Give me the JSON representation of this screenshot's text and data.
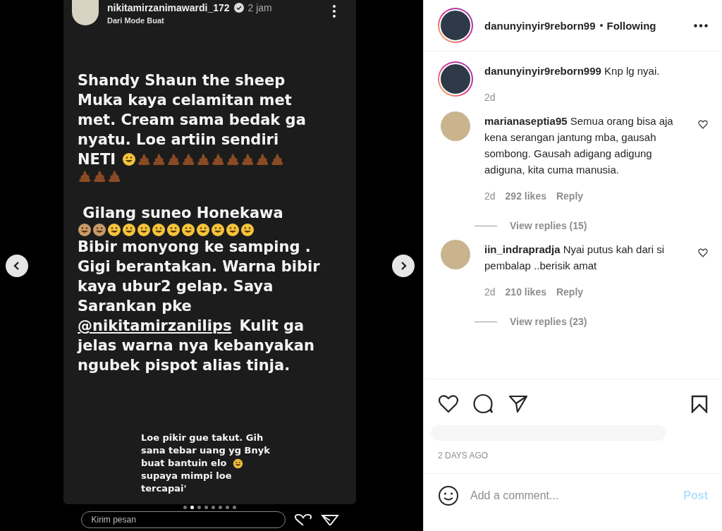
{
  "story": {
    "username": "nikitamirzanimawardi_172",
    "verified": true,
    "time": "2 jam",
    "subtitle": "Dari Mode Buat",
    "blocks": [
      {
        "kind": "caption",
        "lines": [
          [
            {
              "kind": "text",
              "text": "Shandy Shaun the sheep"
            }
          ],
          [
            {
              "kind": "text",
              "text": "Muka kaya celamitan met"
            }
          ],
          [
            {
              "kind": "text",
              "text": "met. Cream sama bedak ga"
            }
          ],
          [
            {
              "kind": "text",
              "text": "nyatu. Loe artiin sendiri"
            }
          ],
          [
            {
              "kind": "text",
              "text": "NETI"
            },
            {
              "kind": "laugh"
            },
            {
              "kind": "poop"
            },
            {
              "kind": "poop"
            },
            {
              "kind": "poop"
            },
            {
              "kind": "poop"
            },
            {
              "kind": "poop"
            },
            {
              "kind": "poop"
            },
            {
              "kind": "poop"
            },
            {
              "kind": "poop"
            },
            {
              "kind": "poop"
            },
            {
              "kind": "poop"
            }
          ],
          [
            {
              "kind": "poop"
            },
            {
              "kind": "poop"
            },
            {
              "kind": "poop"
            }
          ]
        ]
      },
      {
        "kind": "caption",
        "lines": [
          [
            {
              "kind": "text",
              "text": " Gilang suneo Honekawa"
            }
          ],
          [
            {
              "kind": "monkey"
            },
            {
              "kind": "monkey"
            },
            {
              "kind": "laugh"
            },
            {
              "kind": "laugh"
            },
            {
              "kind": "laugh"
            },
            {
              "kind": "laugh"
            },
            {
              "kind": "laugh"
            },
            {
              "kind": "laugh"
            },
            {
              "kind": "laugh"
            },
            {
              "kind": "laugh"
            },
            {
              "kind": "laugh"
            },
            {
              "kind": "laugh"
            }
          ],
          [
            {
              "kind": "text",
              "text": "Bibir monyong ke samping ."
            }
          ],
          [
            {
              "kind": "text",
              "text": "Gigi berantakan. Warna bibir"
            }
          ],
          [
            {
              "kind": "text",
              "text": "kaya ubur2 gelap. Saya"
            }
          ],
          [
            {
              "kind": "text",
              "text": "Sarankan pke"
            }
          ],
          [
            {
              "kind": "link",
              "text": "@nikitamirzanilips"
            },
            {
              "kind": "text",
              "text": "Kulit ga"
            }
          ],
          [
            {
              "kind": "text",
              "text": "jelas warna nya kebanyakan"
            }
          ],
          [
            {
              "kind": "text",
              "text": "ngubek pispot alias tinja."
            }
          ]
        ]
      },
      {
        "kind": "sticker",
        "lines": [
          [
            {
              "kind": "text",
              "text": "Loe pikir gue takut. Gih"
            }
          ],
          [
            {
              "kind": "text",
              "text": "sana tebar uang yg Bnyk"
            }
          ],
          [
            {
              "kind": "text",
              "text": "buat bantuin elo"
            },
            {
              "kind": "grin"
            }
          ],
          [
            {
              "kind": "text",
              "text": "supaya mimpi loe"
            }
          ],
          [
            {
              "kind": "text",
              "text": "tercapai'"
            }
          ]
        ]
      }
    ],
    "progress": [
      {
        "selected": false
      },
      {
        "selected": true
      },
      {
        "selected": false
      },
      {
        "selected": false
      },
      {
        "selected": false
      },
      {
        "selected": false
      },
      {
        "selected": false
      },
      {
        "selected": false
      }
    ],
    "reply_placeholder": "Kirim pesan"
  },
  "post": {
    "username": "danunyinyir9reborn99",
    "follow_status": "Following",
    "caption": {
      "username": "danunyinyir9reborn999",
      "text": "Knp lg nyai.",
      "time": "2d"
    },
    "comments": [
      {
        "username": "marianaseptia95",
        "text": "Semua orang bisa aja kena serangan jantung mba, gausah sombong. Gausah adigang adigung adiguna, kita cuma manusia.",
        "time": "2d",
        "likes": "292 likes",
        "reply": "Reply",
        "view_replies": "View replies (15)"
      },
      {
        "username": "iin_indrapradja",
        "text": "Nyai putus kah dari si pembalap ..berisik amat",
        "time": "2d",
        "likes": "210 likes",
        "reply": "Reply",
        "view_replies": "View replies (23)"
      }
    ],
    "date": "2 DAYS AGO",
    "comment_placeholder": "Add a comment...",
    "post_button": "Post",
    "post_enabled": false
  }
}
